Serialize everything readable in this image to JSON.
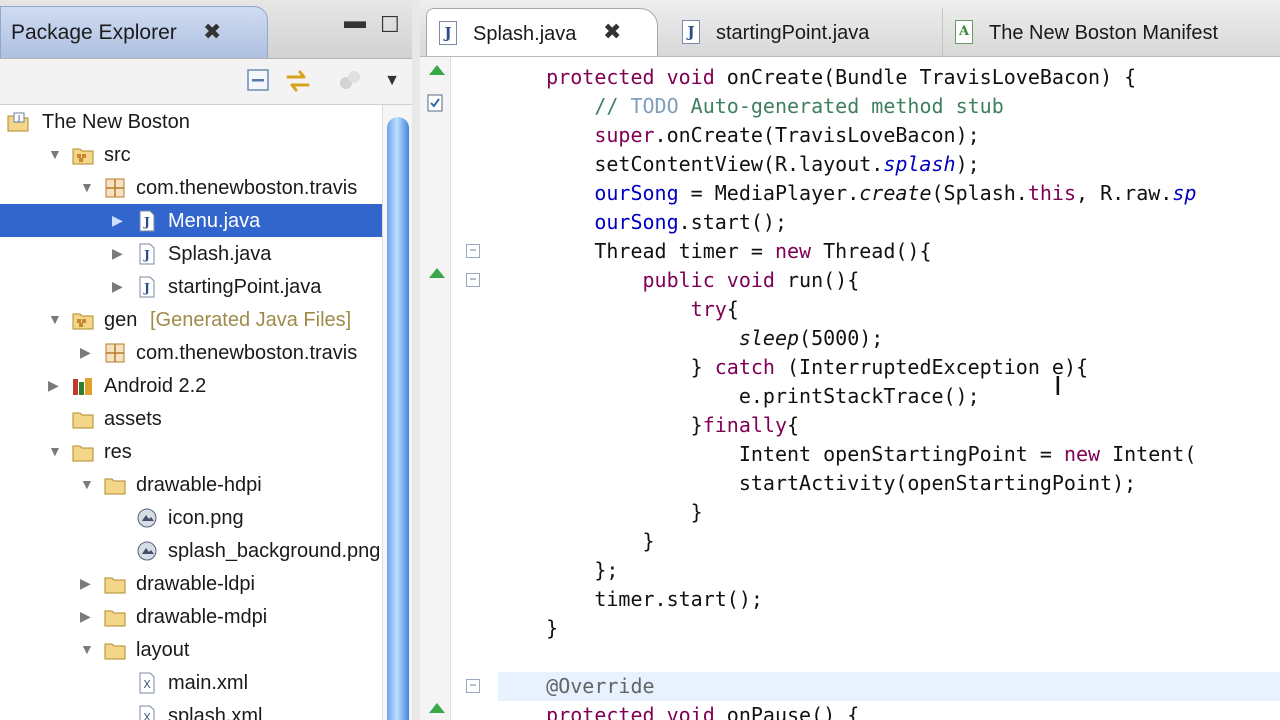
{
  "package_explorer": {
    "title": "Package Explorer",
    "close_glyph": "✖",
    "minimize_glyph": "▬",
    "maximize_glyph": "☐",
    "toolbar": {
      "collapse_icon": "collapse-all-icon",
      "link_icon": "link-with-editor-icon",
      "menu_glyph": "▼"
    },
    "tree": [
      {
        "label": "The New Boston",
        "icon": "project-icon",
        "depth": 0,
        "arrow": ""
      },
      {
        "label": "src",
        "icon": "source-folder-icon",
        "depth": 1,
        "arrow": "▼"
      },
      {
        "label": "com.thenewboston.travis",
        "icon": "package-icon",
        "depth": 2,
        "arrow": "▼"
      },
      {
        "label": "Menu.java",
        "icon": "java-file-icon",
        "depth": 3,
        "arrow": "▶",
        "selected": true
      },
      {
        "label": "Splash.java",
        "icon": "java-file-icon",
        "depth": 3,
        "arrow": "▶"
      },
      {
        "label": "startingPoint.java",
        "icon": "java-file-icon",
        "depth": 3,
        "arrow": "▶"
      },
      {
        "label": "gen",
        "decoration": "[Generated Java Files]",
        "icon": "source-folder-icon",
        "depth": 1,
        "arrow": "▼"
      },
      {
        "label": "com.thenewboston.travis",
        "icon": "package-icon",
        "depth": 2,
        "arrow": "▶"
      },
      {
        "label": "Android 2.2",
        "icon": "library-icon",
        "depth": 1,
        "arrow": "▶"
      },
      {
        "label": "assets",
        "icon": "folder-icon",
        "depth": 1,
        "arrow": ""
      },
      {
        "label": "res",
        "icon": "folder-icon",
        "depth": 1,
        "arrow": "▼"
      },
      {
        "label": "drawable-hdpi",
        "icon": "folder-icon",
        "depth": 2,
        "arrow": "▼"
      },
      {
        "label": "icon.png",
        "icon": "image-file-icon",
        "depth": 3,
        "arrow": ""
      },
      {
        "label": "splash_background.png",
        "icon": "image-file-icon",
        "depth": 3,
        "arrow": ""
      },
      {
        "label": "drawable-ldpi",
        "icon": "folder-icon",
        "depth": 2,
        "arrow": "▶"
      },
      {
        "label": "drawable-mdpi",
        "icon": "folder-icon",
        "depth": 2,
        "arrow": "▶"
      },
      {
        "label": "layout",
        "icon": "folder-icon",
        "depth": 2,
        "arrow": "▼"
      },
      {
        "label": "main.xml",
        "icon": "xml-file-icon",
        "depth": 3,
        "arrow": ""
      },
      {
        "label": "splash.xml",
        "icon": "xml-file-icon",
        "depth": 3,
        "arrow": ""
      }
    ]
  },
  "editor": {
    "tabs": [
      {
        "label": "Splash.java",
        "icon": "java-file-icon",
        "active": true,
        "close_glyph": "✖"
      },
      {
        "label": "startingPoint.java",
        "icon": "java-file-icon",
        "active": false
      },
      {
        "label": "The New Boston Manifest",
        "icon": "manifest-file-icon",
        "active": false
      }
    ],
    "lines": [
      [
        [
          "    ",
          ""
        ],
        [
          "protected",
          "kw"
        ],
        [
          " ",
          ""
        ],
        [
          "void",
          "kw"
        ],
        [
          " onCreate(Bundle TravisLoveBacon) {",
          ""
        ]
      ],
      [
        [
          "        ",
          ""
        ],
        [
          "// ",
          "cmt"
        ],
        [
          "TODO",
          "todo"
        ],
        [
          " Auto-generated method stub",
          "cmt"
        ]
      ],
      [
        [
          "        ",
          ""
        ],
        [
          "super",
          "kw"
        ],
        [
          ".onCreate(TravisLoveBacon);",
          ""
        ]
      ],
      [
        [
          "        setContentView(R.layout.",
          ""
        ],
        [
          "splash",
          "fld ita"
        ],
        [
          ");",
          ""
        ]
      ],
      [
        [
          "        ",
          ""
        ],
        [
          "ourSong",
          "fld"
        ],
        [
          " = MediaPlayer.",
          ""
        ],
        [
          "create",
          "ita"
        ],
        [
          "(Splash.",
          ""
        ],
        [
          "this",
          "kw"
        ],
        [
          ", R.raw.",
          ""
        ],
        [
          "sp",
          "fld ita"
        ]
      ],
      [
        [
          "        ",
          ""
        ],
        [
          "ourSong",
          "fld"
        ],
        [
          ".start();",
          ""
        ]
      ],
      [
        [
          "        Thread timer = ",
          ""
        ],
        [
          "new",
          "kw"
        ],
        [
          " Thread(){",
          ""
        ]
      ],
      [
        [
          "            ",
          ""
        ],
        [
          "public",
          "kw"
        ],
        [
          " ",
          ""
        ],
        [
          "void",
          "kw"
        ],
        [
          " run(){",
          ""
        ]
      ],
      [
        [
          "                ",
          ""
        ],
        [
          "try",
          "kw"
        ],
        [
          "{",
          ""
        ]
      ],
      [
        [
          "                    ",
          ""
        ],
        [
          "sleep",
          "ita"
        ],
        [
          "(5000);",
          ""
        ]
      ],
      [
        [
          "                } ",
          ""
        ],
        [
          "catch",
          "kw"
        ],
        [
          " (InterruptedException e){",
          ""
        ]
      ],
      [
        [
          "                    e.printStackTrace();",
          ""
        ]
      ],
      [
        [
          "                }",
          ""
        ],
        [
          "finally",
          "kw"
        ],
        [
          "{",
          ""
        ]
      ],
      [
        [
          "                    Intent openStartingPoint = ",
          ""
        ],
        [
          "new",
          "kw"
        ],
        [
          " Intent(",
          ""
        ]
      ],
      [
        [
          "                    startActivity(openStartingPoint);",
          ""
        ]
      ],
      [
        [
          "                }",
          ""
        ]
      ],
      [
        [
          "            }",
          ""
        ]
      ],
      [
        [
          "        };",
          ""
        ]
      ],
      [
        [
          "        timer.start();",
          ""
        ]
      ],
      [
        [
          "    }",
          ""
        ]
      ],
      [
        [
          "",
          ""
        ]
      ],
      [
        [
          "    ",
          ""
        ],
        [
          "@Override",
          "ann"
        ]
      ],
      [
        [
          "    ",
          ""
        ],
        [
          "protected",
          "kw"
        ],
        [
          " ",
          ""
        ],
        [
          "void",
          "kw"
        ],
        [
          " onPause() {",
          ""
        ]
      ]
    ],
    "override_markers": [
      0,
      7,
      22
    ],
    "fold_markers": [
      6,
      7,
      21
    ],
    "highlight_line": 21,
    "cursor_glyph": "I"
  }
}
